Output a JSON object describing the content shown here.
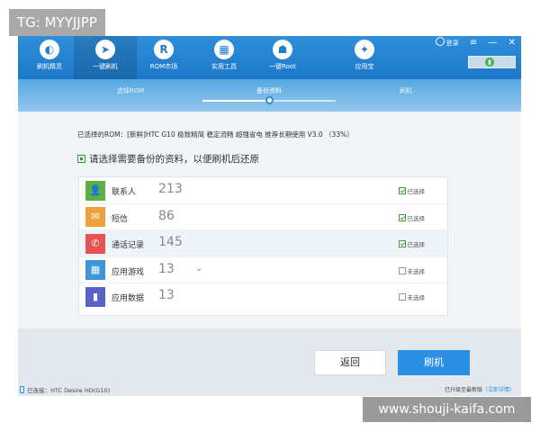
{
  "watermarks": {
    "top_left": "TG: MYYJJPP",
    "bottom_right": "www.shouji-kaifa.com"
  },
  "toolbar": {
    "items": [
      {
        "label": "刷机精灵",
        "icon": "sprite-icon",
        "glyph": "◐",
        "active": false
      },
      {
        "label": "一键刷机",
        "icon": "cursor-icon",
        "glyph": "➤",
        "active": true
      },
      {
        "label": "ROM市场",
        "icon": "rom-market-icon",
        "glyph": "R",
        "active": false
      },
      {
        "label": "实用工具",
        "icon": "tools-grid-icon",
        "glyph": "▦",
        "active": false
      },
      {
        "label": "一键Root",
        "icon": "root-icon",
        "glyph": "☗",
        "active": false
      },
      {
        "label": "应用宝",
        "icon": "app-store-icon",
        "glyph": "✦",
        "active": false
      }
    ],
    "login_label": "登录",
    "menu_glyph": "≡",
    "minimize_glyph": "—",
    "close_glyph": "✕",
    "toggle_glyph": "▮"
  },
  "steps": [
    {
      "label": "选择ROM",
      "status": "done"
    },
    {
      "label": "备份资料",
      "status": "current"
    },
    {
      "label": "刷机",
      "status": "pending"
    }
  ],
  "selected_rom": "已选择的ROM：[新鲜]HTC G10 极致精简 稳定流畅 超强省电 推荐长期使用 V3.0 （33%）",
  "instruction": "请选择需要备份的资料，以便刷机后还原",
  "backup_items": [
    {
      "label": "联系人",
      "count": "213",
      "status": "已选择",
      "checked": true,
      "icon": "contacts-icon",
      "glyph": "👤",
      "color": "#5bb042",
      "chevron": false,
      "highlight": false
    },
    {
      "label": "短信",
      "count": "86",
      "status": "已选择",
      "checked": true,
      "icon": "sms-icon",
      "glyph": "✉",
      "color": "#f0a23a",
      "chevron": false,
      "highlight": false
    },
    {
      "label": "通话记录",
      "count": "145",
      "status": "已选择",
      "checked": true,
      "icon": "phone-call-icon",
      "glyph": "✆",
      "color": "#e65353",
      "chevron": false,
      "highlight": true
    },
    {
      "label": "应用游戏",
      "count": "13",
      "status": "未选择",
      "checked": false,
      "icon": "apps-icon",
      "glyph": "▦",
      "color": "#3d95db",
      "chevron": true,
      "highlight": false
    },
    {
      "label": "应用数据",
      "count": "13",
      "status": "未选择",
      "checked": false,
      "icon": "app-data-icon",
      "glyph": "▮",
      "color": "#5a62c9",
      "chevron": false,
      "highlight": false
    }
  ],
  "chevron_glyph": "⌄",
  "buttons": {
    "back": "返回",
    "flash": "刷机"
  },
  "status_bar": {
    "device": "已连接：HTC Desire HD(G10)",
    "upgrade": "已升级至最新版",
    "details_link": "（立即详情）"
  }
}
